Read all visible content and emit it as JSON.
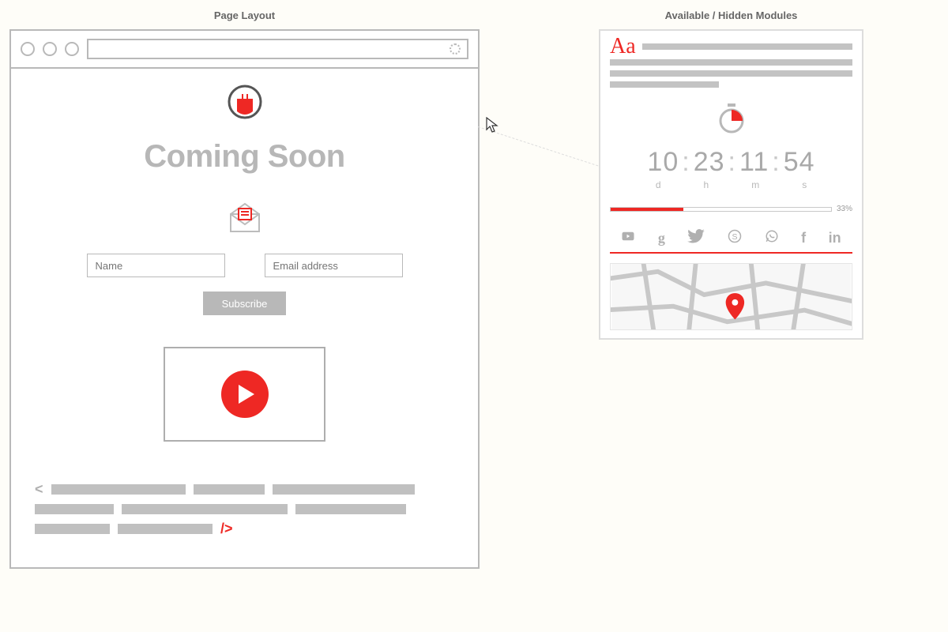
{
  "left": {
    "title": "Page Layout",
    "headline": "Coming Soon",
    "name_placeholder": "Name",
    "email_placeholder": "Email address",
    "subscribe_label": "Subscribe"
  },
  "right": {
    "title": "Available / Hidden Modules",
    "typography_dropcap": "Aa",
    "countdown": {
      "d": "10",
      "h": "23",
      "m": "11",
      "s": "54",
      "label_d": "d",
      "label_h": "h",
      "label_m": "m",
      "label_s": "s",
      "separator": ":"
    },
    "progress": {
      "percent_label": "33%",
      "percent_value": 33
    },
    "social": [
      "youtube",
      "google",
      "twitter",
      "skype",
      "whatsapp",
      "facebook",
      "linkedin"
    ]
  }
}
